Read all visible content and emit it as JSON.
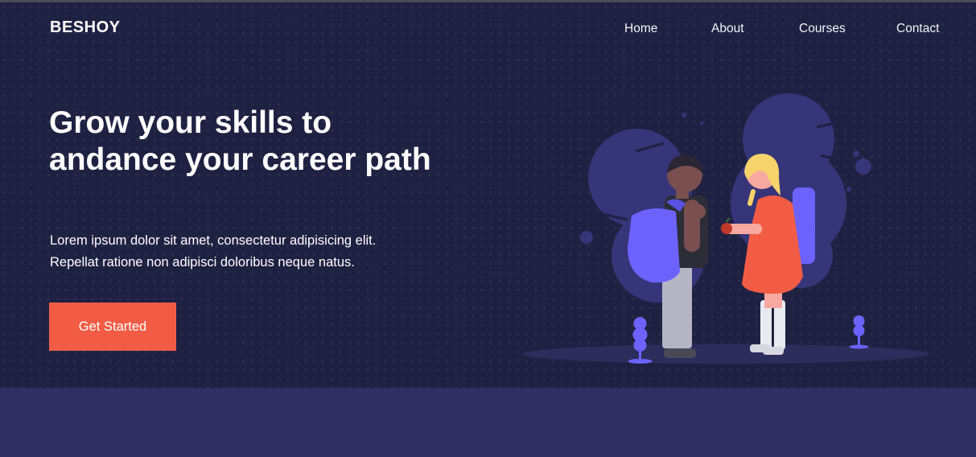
{
  "brand": {
    "logo": "BESHOY"
  },
  "nav": {
    "items": [
      "Home",
      "About",
      "Courses",
      "Contact"
    ]
  },
  "hero": {
    "headline": "Grow your skills to andance your career path",
    "description_line1": "Lorem ipsum dolor sit amet, consectetur adipisicing elit.",
    "description_line2": "Repellat ratione non adipisci doloribus neque natus.",
    "cta_label": "Get Started"
  },
  "illustration": {
    "name": "students-with-backpacks",
    "colors": {
      "blob": "#3b3a86",
      "backpack": "#6c63ff",
      "dress": "#f25c45",
      "hair": "#f6d36b"
    }
  },
  "colors": {
    "hero_background": "#1f2142",
    "section_background": "#2f2f63",
    "accent": "#f25c45",
    "text": "#ffffff"
  }
}
